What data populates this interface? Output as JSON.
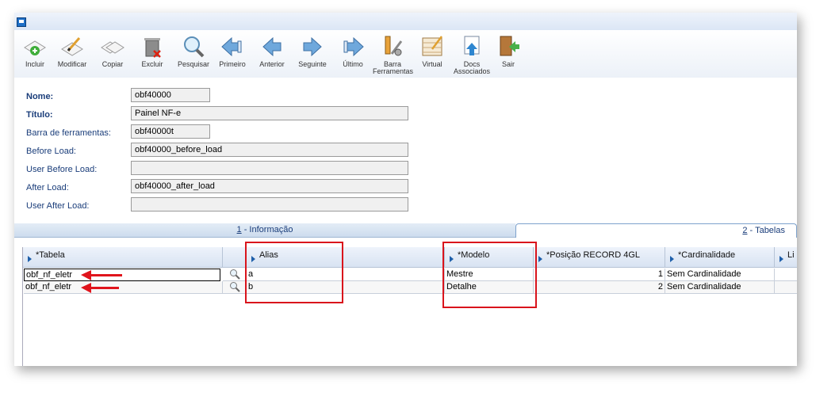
{
  "toolbar": {
    "buttons": [
      {
        "label": "Incluir",
        "icon": "add-icon"
      },
      {
        "label": "Modificar",
        "icon": "edit-icon"
      },
      {
        "label": "Copiar",
        "icon": "copy-icon"
      },
      {
        "label": "Excluir",
        "icon": "trash-icon"
      },
      {
        "label": "Pesquisar",
        "icon": "search-icon"
      },
      {
        "label": "Primeiro",
        "icon": "first-icon"
      },
      {
        "label": "Anterior",
        "icon": "previous-icon"
      },
      {
        "label": "Seguinte",
        "icon": "next-icon"
      },
      {
        "label": "Último",
        "icon": "last-icon"
      },
      {
        "label": "Barra\nFerramentas",
        "icon": "toolbar-tools-icon"
      },
      {
        "label": "Virtual",
        "icon": "virtual-icon"
      },
      {
        "label": "Docs\nAssociados",
        "icon": "docs-icon"
      },
      {
        "label": "Sair",
        "icon": "exit-icon"
      }
    ]
  },
  "form": {
    "nome_label": "Nome:",
    "nome_value": "obf40000",
    "titulo_label": "Título:",
    "titulo_value": "Painel NF-e",
    "barra_label": "Barra de ferramentas:",
    "barra_value": "obf40000t",
    "before_label": "Before Load:",
    "before_value": "obf40000_before_load",
    "user_before_label": "User Before Load:",
    "user_before_value": "",
    "after_label": "After Load:",
    "after_value": "obf40000_after_load",
    "user_after_label": "User After Load:",
    "user_after_value": ""
  },
  "tabs": {
    "tab1_key": "1",
    "tab1_label": " - Informação",
    "tab2_key": "2",
    "tab2_label": " - Tabelas"
  },
  "grid": {
    "headers": [
      "*Tabela",
      "Alias",
      "*Modelo",
      "*Posição RECORD 4GL",
      "*Cardinalidade",
      "Li"
    ],
    "rows": [
      {
        "tabela": "obf_nf_eletr",
        "alias": "a",
        "modelo": "Mestre",
        "posicao": "1",
        "cardinalidade": "Sem Cardinalidade"
      },
      {
        "tabela": "obf_nf_eletr",
        "alias": "b",
        "modelo": "Detalhe",
        "posicao": "2",
        "cardinalidade": "Sem Cardinalidade"
      }
    ]
  },
  "colors": {
    "label_blue": "#1a3d7a",
    "annotation_red": "#d9141c"
  }
}
